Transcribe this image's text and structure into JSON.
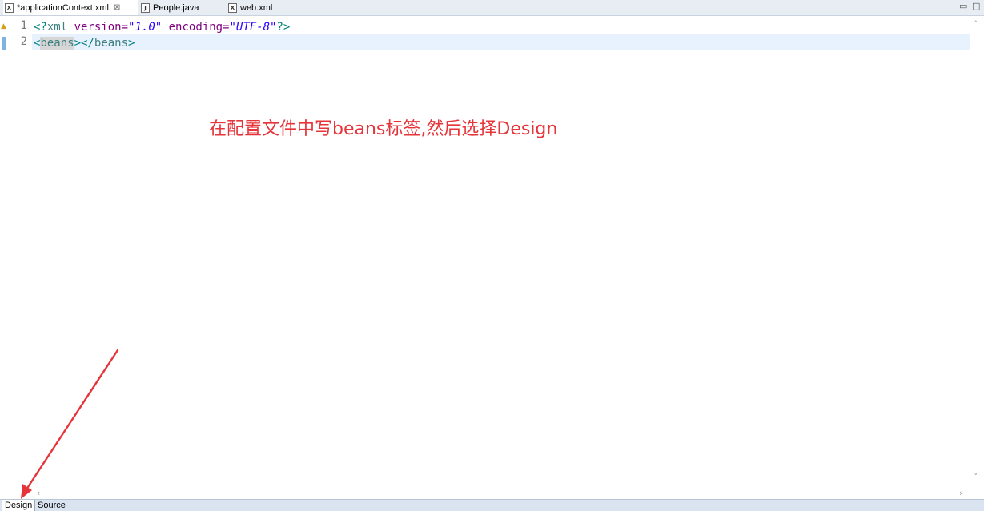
{
  "tabs": [
    {
      "icon": "X",
      "label": "*applicationContext.xml",
      "close": "⊠"
    },
    {
      "icon": "J",
      "label": "People.java"
    },
    {
      "icon": "X",
      "label": "web.xml"
    }
  ],
  "window_controls": {
    "minimize": "▭",
    "maximize": "□"
  },
  "editor": {
    "line_numbers": [
      "1",
      "2"
    ],
    "line1": {
      "prolog_open": "<?",
      "xml": "xml",
      "space1": " ",
      "version_attr": "version=",
      "version_value": "\"1.0\"",
      "space2": " ",
      "encoding_attr": "encoding=",
      "encoding_value": "\"UTF-8\"",
      "prolog_close": "?>"
    },
    "line2": {
      "lt": "<",
      "open_tag": "beans",
      "gt": ">",
      "close_lt": "</",
      "close_tag": "beans",
      "close_gt": ">"
    }
  },
  "annotation": "在配置文件中写beans标签,然后选择Design",
  "scroll": {
    "up": "˄",
    "down": "˅",
    "left": "‹",
    "right": "›"
  },
  "page_tabs": [
    {
      "label": "Design",
      "active": true
    },
    {
      "label": "Source",
      "active": false
    }
  ],
  "colors": {
    "annotation": "#e5343a",
    "arrow": "#e5343a",
    "current_line": "#e8f2fe"
  }
}
